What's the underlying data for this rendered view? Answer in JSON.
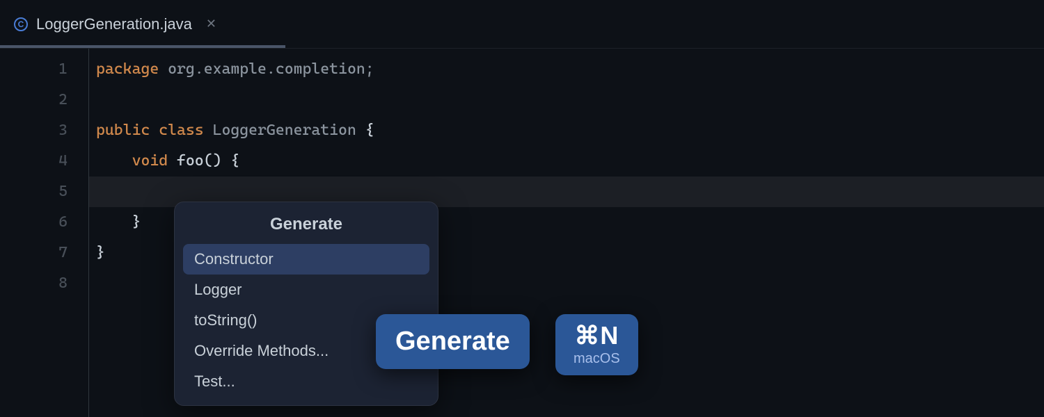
{
  "tab": {
    "icon_letter": "C",
    "title": "LoggerGeneration.java"
  },
  "gutter": {
    "lines": [
      "1",
      "2",
      "3",
      "4",
      "5",
      "6",
      "7",
      "8"
    ]
  },
  "code": {
    "line1_kw": "package",
    "line1_rest": " org.example.completion;",
    "line3_kw1": "public",
    "line3_kw2": " class",
    "line3_name": " LoggerGeneration ",
    "line3_brace": "{",
    "line4_indent": "    ",
    "line4_kw": "void",
    "line4_rest": " foo() {",
    "line6_indent": "    ",
    "line6_brace": "}",
    "line7_brace": "}"
  },
  "popup": {
    "title": "Generate",
    "items": [
      "Constructor",
      "Logger",
      "toString()",
      "Override Methods...",
      "Test..."
    ]
  },
  "hints": {
    "action": "Generate",
    "shortcut": "⌘N",
    "os": "macOS"
  }
}
